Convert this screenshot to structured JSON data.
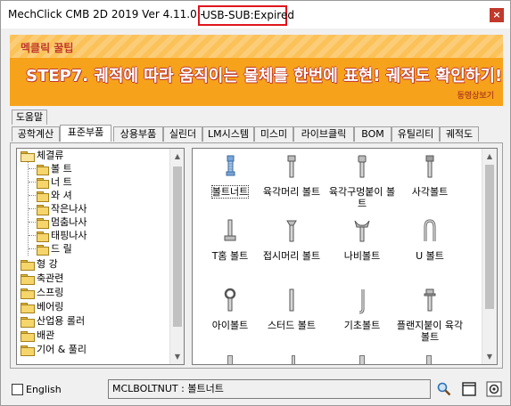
{
  "window": {
    "title": "MechClick CMB 2D 2019   Ver 4.11.0 - ",
    "license": "USB-SUB:Expired",
    "close_label": "×"
  },
  "banner": {
    "tag": "멕클릭 꿀팁",
    "headline": "STEP7. 궤적에 따라 움직이는 물체를 한번에 표현! 궤적도 확인하기!",
    "link": "동영상보기"
  },
  "tabs_row1": [
    {
      "label": "도움말"
    }
  ],
  "tabs_row2": [
    {
      "label": "공학계산"
    },
    {
      "label": "표준부품"
    },
    {
      "label": "상용부품"
    },
    {
      "label": "실린더"
    },
    {
      "label": "LM시스템"
    },
    {
      "label": "미스미"
    },
    {
      "label": "라이브클릭"
    },
    {
      "label": "BOM"
    },
    {
      "label": "유틸리티"
    },
    {
      "label": "궤적도"
    }
  ],
  "tree": {
    "items": [
      {
        "label": "체결류"
      },
      {
        "label": "볼 트"
      },
      {
        "label": "너 트"
      },
      {
        "label": "와 셔"
      },
      {
        "label": "작은나사"
      },
      {
        "label": "멈춤나사"
      },
      {
        "label": "태핑나사"
      },
      {
        "label": "드 릴"
      },
      {
        "label": "형 강"
      },
      {
        "label": "축관련"
      },
      {
        "label": "스프링"
      },
      {
        "label": "베어링"
      },
      {
        "label": "산업용 롤러"
      },
      {
        "label": "배관"
      },
      {
        "label": "기어 & 풀리"
      }
    ]
  },
  "parts": [
    {
      "label": "볼트너트",
      "icon": "bolt-nut-icon"
    },
    {
      "label": "육각머리 볼트",
      "icon": "hex-bolt-icon"
    },
    {
      "label": "육각구멍붙이 볼트",
      "icon": "socket-bolt-icon"
    },
    {
      "label": "사각볼트",
      "icon": "square-bolt-icon"
    },
    {
      "label": "T홈 볼트",
      "icon": "t-slot-bolt-icon"
    },
    {
      "label": "접시머리 볼트",
      "icon": "countersunk-bolt-icon"
    },
    {
      "label": "나비볼트",
      "icon": "wing-bolt-icon"
    },
    {
      "label": "U 볼트",
      "icon": "u-bolt-icon"
    },
    {
      "label": "아이볼트",
      "icon": "eye-bolt-icon"
    },
    {
      "label": "스터드 볼트",
      "icon": "stud-bolt-icon"
    },
    {
      "label": "기초볼트",
      "icon": "foundation-bolt-icon"
    },
    {
      "label": "플랜지붙이 육각볼트",
      "icon": "flange-bolt-icon"
    }
  ],
  "status": {
    "english_label": "English",
    "code_text": "MCLBOLTNUT : 볼트너트"
  }
}
